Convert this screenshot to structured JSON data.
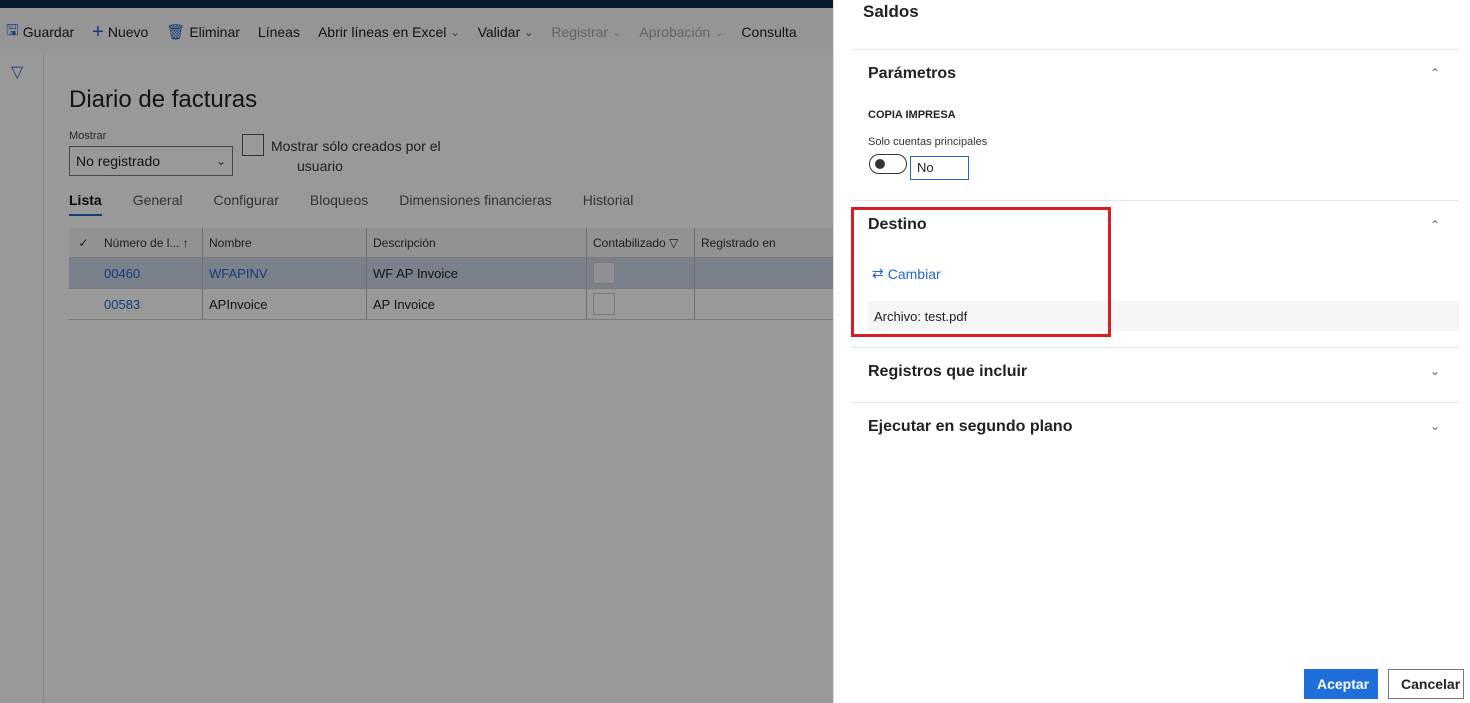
{
  "toolbar": {
    "items": [
      {
        "label": "Guardar",
        "icon": "save-icon"
      },
      {
        "label": "Nuevo",
        "icon": "plus-icon"
      },
      {
        "label": "Eliminar",
        "icon": "trash-icon"
      },
      {
        "label": "Líneas"
      },
      {
        "label": "Abrir líneas en Excel"
      },
      {
        "label": "Validar"
      },
      {
        "label": "Registrar"
      },
      {
        "label": "Aprobación"
      },
      {
        "label": "Consulta"
      }
    ]
  },
  "page": {
    "title": "Diario de facturas",
    "mostrar_label": "Mostrar",
    "mostrar_value": "No registrado",
    "checkbox_label_line1": "Mostrar sólo creados por el",
    "checkbox_label_line2": "usuario",
    "tabs": [
      "Lista",
      "General",
      "Configurar",
      "Bloqueos",
      "Dimensiones financieras",
      "Historial"
    ]
  },
  "grid": {
    "headers": [
      "Número de l...",
      "Nombre",
      "Descripción",
      "Contabilizado",
      "Registrado en"
    ],
    "rows": [
      {
        "numero": "00460",
        "nombre": "WFAPINV",
        "descripcion": "WF AP Invoice"
      },
      {
        "numero": "00583",
        "nombre": "APInvoice",
        "descripcion": "AP Invoice"
      }
    ]
  },
  "panel": {
    "title": "Saldos",
    "parametros": {
      "title": "Parámetros",
      "copia": "COPIA IMPRESA",
      "solo_label": "Solo cuentas principales",
      "toggle_value": "No"
    },
    "destino": {
      "title": "Destino",
      "cambiar": "Cambiar",
      "archivo": "Archivo: test.pdf"
    },
    "registros": {
      "title": "Registros que incluir"
    },
    "ejecutar": {
      "title": "Ejecutar en segundo plano"
    },
    "aceptar": "Aceptar",
    "cancelar": "Cancelar"
  },
  "colors": {
    "accent": "#2266cc",
    "highlight": "#d81c24",
    "primary_button": "#1e6fdc"
  }
}
